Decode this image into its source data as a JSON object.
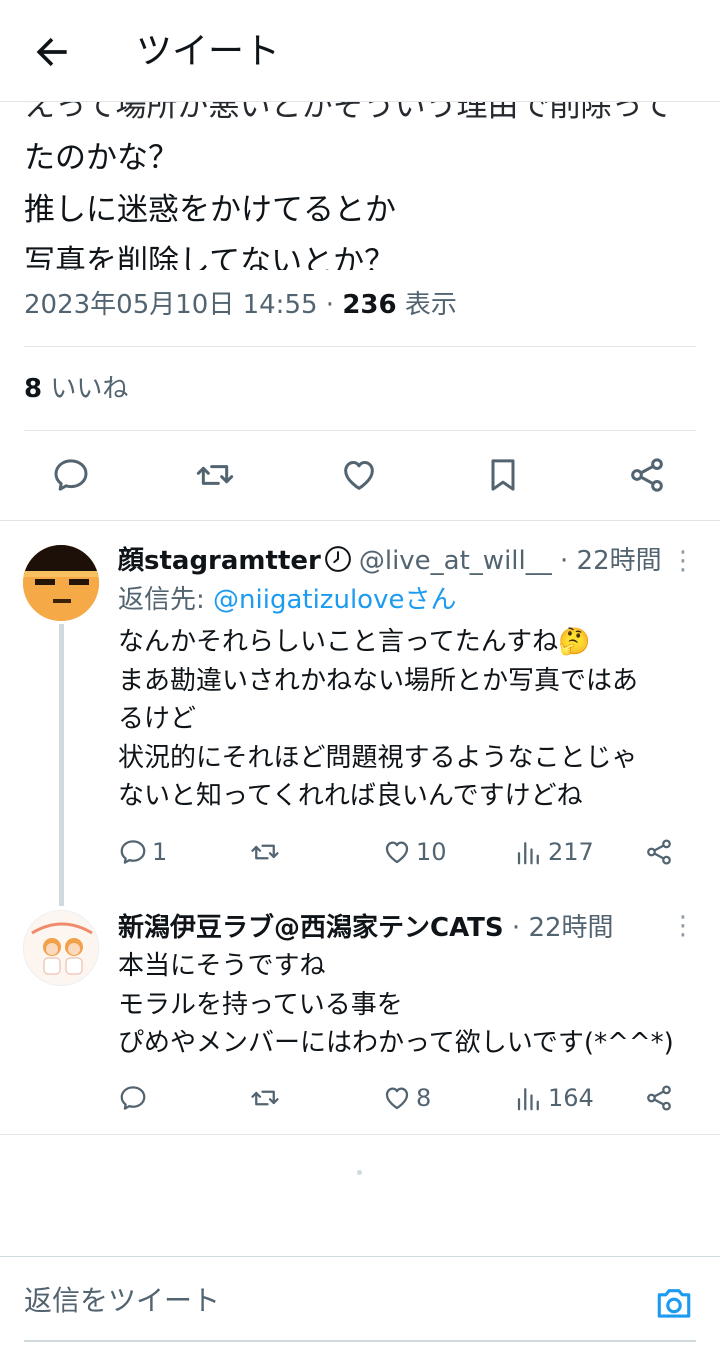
{
  "header": {
    "title": "ツイート"
  },
  "tweet": {
    "lines": [
      "えって場所が悪いとかそういう理由で削除って",
      "たのかな？",
      "推しに迷惑をかけてるとか",
      "写真を削除してないとか？"
    ],
    "timestamp": "2023年05月10日 14:55 · ",
    "views_count": "236",
    "views_label": " 表示",
    "likes_count": "8",
    "likes_label": " いいね"
  },
  "replies": [
    {
      "name": "顔stagramtter",
      "handle": "@live_at_will__",
      "time": "· 22時間",
      "reply_to_label": "返信先: ",
      "reply_to_mention": "@niigatizuloveさん",
      "lines": [
        "なんかそれらしいこと言ってたんすね🤔",
        "まあ勘違いされかねない場所とか写真ではあ",
        "るけど",
        "状況的にそれほど問題視するようなことじゃ",
        "ないと知ってくれれば良いんですけどね"
      ],
      "replies": "1",
      "likes": "10",
      "views": "217"
    },
    {
      "name": "新潟伊豆ラブ@西潟家テンCATS",
      "time": "· 22時間",
      "lines": [
        "本当にそうですね",
        "モラルを持っている事を",
        "ぴめやメンバーにはわかって欲しいです(*^^*)"
      ],
      "likes": "8",
      "views": "164"
    }
  ],
  "compose": {
    "placeholder": "返信をツイート"
  },
  "colors": {
    "accent": "#1d9bf0",
    "secondary_text": "#536471",
    "divider": "#e1e5e8"
  }
}
